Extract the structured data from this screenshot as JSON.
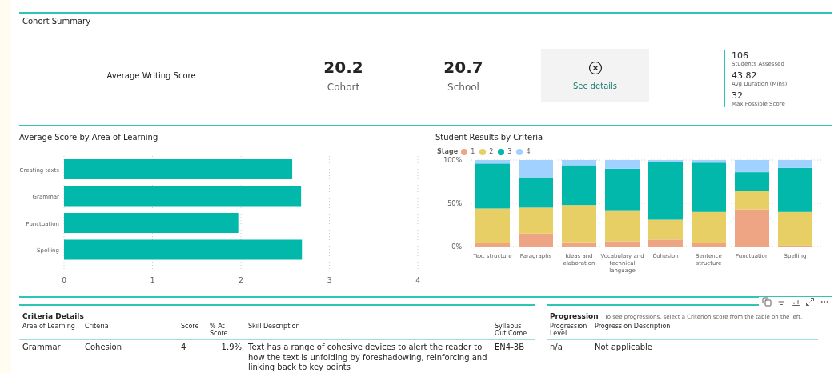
{
  "summary": {
    "title": "Cohort Summary",
    "metric_label": "Average Writing Score",
    "scores": [
      {
        "value": "20.2",
        "label": "Cohort"
      },
      {
        "value": "20.7",
        "label": "School"
      }
    ],
    "details_link": "See details",
    "stats": [
      {
        "value": "106",
        "label": "Students Assessed"
      },
      {
        "value": "43.82",
        "label": "Avg Duration (Mins)"
      },
      {
        "value": "32",
        "label": "Max Possible Score"
      }
    ]
  },
  "area_chart": {
    "chart_data": {
      "type": "bar",
      "orientation": "horizontal",
      "title": "Average Score by Area of Learning",
      "categories": [
        "Creating texts",
        "Grammar",
        "Punctuation",
        "Spelling"
      ],
      "values": [
        2.58,
        2.68,
        1.97,
        2.69
      ],
      "xlim": [
        0,
        4
      ],
      "xticks": [
        0,
        1,
        2,
        3,
        4
      ],
      "grid": true
    }
  },
  "criteria_chart": {
    "legend_title": "Stage",
    "chart_data": {
      "type": "bar",
      "stacked": true,
      "title": "Student Results by Criteria",
      "categories": [
        "Text structure",
        "Paragraphs",
        "Ideas and elaboration",
        "Vocabulary and technical language",
        "Cohesion",
        "Sentence structure",
        "Punctuation",
        "Spelling"
      ],
      "series": [
        {
          "name": "1",
          "color": "#eda584",
          "values": [
            4,
            15,
            5,
            6,
            8,
            4,
            43,
            1
          ]
        },
        {
          "name": "2",
          "color": "#e7cf66",
          "values": [
            40,
            30,
            43,
            36,
            23,
            36,
            21,
            39
          ]
        },
        {
          "name": "3",
          "color": "#01b8aa",
          "values": [
            52,
            35,
            46,
            48,
            67,
            57,
            22,
            51
          ]
        },
        {
          "name": "4",
          "color": "#a0d1ff",
          "values": [
            4,
            20,
            6,
            10,
            2,
            3,
            14,
            9
          ]
        }
      ],
      "ylim": [
        0,
        100
      ],
      "yticks": [
        {
          "value": 0,
          "label": "0%"
        },
        {
          "value": 50,
          "label": "50%"
        },
        {
          "value": 100,
          "label": "100%"
        }
      ]
    }
  },
  "criteria_details": {
    "title": "Criteria Details",
    "columns": [
      "Area of Learning",
      "Criteria",
      "Score",
      "% At Score",
      "Skill Description",
      "Syllabus Out Come"
    ],
    "rows": [
      [
        "Grammar",
        "Cohesion",
        "4",
        "1.9%",
        "Text has a range of cohesive devices to alert the reader to how the text is unfolding by foreshadowing, reinforcing and linking back to key points",
        "EN4-3B"
      ]
    ]
  },
  "progression": {
    "title": "Progression",
    "hint": "To see progressions, select a Criterion score from the table on the left.",
    "columns": [
      "Progression Level",
      "Progression Description"
    ],
    "rows": [
      [
        "n/a",
        "Not applicable"
      ]
    ]
  }
}
